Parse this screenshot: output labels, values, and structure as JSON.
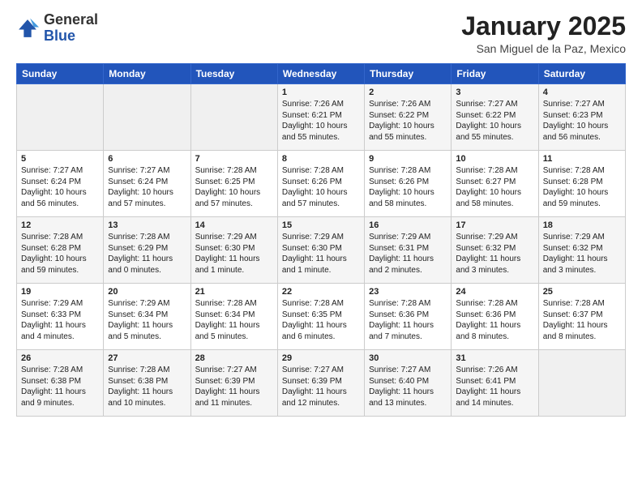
{
  "header": {
    "logo_general": "General",
    "logo_blue": "Blue",
    "main_title": "January 2025",
    "subtitle": "San Miguel de la Paz, Mexico"
  },
  "weekdays": [
    "Sunday",
    "Monday",
    "Tuesday",
    "Wednesday",
    "Thursday",
    "Friday",
    "Saturday"
  ],
  "weeks": [
    [
      {
        "day": "",
        "info": ""
      },
      {
        "day": "",
        "info": ""
      },
      {
        "day": "",
        "info": ""
      },
      {
        "day": "1",
        "info": "Sunrise: 7:26 AM\nSunset: 6:21 PM\nDaylight: 10 hours\nand 55 minutes."
      },
      {
        "day": "2",
        "info": "Sunrise: 7:26 AM\nSunset: 6:22 PM\nDaylight: 10 hours\nand 55 minutes."
      },
      {
        "day": "3",
        "info": "Sunrise: 7:27 AM\nSunset: 6:22 PM\nDaylight: 10 hours\nand 55 minutes."
      },
      {
        "day": "4",
        "info": "Sunrise: 7:27 AM\nSunset: 6:23 PM\nDaylight: 10 hours\nand 56 minutes."
      }
    ],
    [
      {
        "day": "5",
        "info": "Sunrise: 7:27 AM\nSunset: 6:24 PM\nDaylight: 10 hours\nand 56 minutes."
      },
      {
        "day": "6",
        "info": "Sunrise: 7:27 AM\nSunset: 6:24 PM\nDaylight: 10 hours\nand 57 minutes."
      },
      {
        "day": "7",
        "info": "Sunrise: 7:28 AM\nSunset: 6:25 PM\nDaylight: 10 hours\nand 57 minutes."
      },
      {
        "day": "8",
        "info": "Sunrise: 7:28 AM\nSunset: 6:26 PM\nDaylight: 10 hours\nand 57 minutes."
      },
      {
        "day": "9",
        "info": "Sunrise: 7:28 AM\nSunset: 6:26 PM\nDaylight: 10 hours\nand 58 minutes."
      },
      {
        "day": "10",
        "info": "Sunrise: 7:28 AM\nSunset: 6:27 PM\nDaylight: 10 hours\nand 58 minutes."
      },
      {
        "day": "11",
        "info": "Sunrise: 7:28 AM\nSunset: 6:28 PM\nDaylight: 10 hours\nand 59 minutes."
      }
    ],
    [
      {
        "day": "12",
        "info": "Sunrise: 7:28 AM\nSunset: 6:28 PM\nDaylight: 10 hours\nand 59 minutes."
      },
      {
        "day": "13",
        "info": "Sunrise: 7:28 AM\nSunset: 6:29 PM\nDaylight: 11 hours\nand 0 minutes."
      },
      {
        "day": "14",
        "info": "Sunrise: 7:29 AM\nSunset: 6:30 PM\nDaylight: 11 hours\nand 1 minute."
      },
      {
        "day": "15",
        "info": "Sunrise: 7:29 AM\nSunset: 6:30 PM\nDaylight: 11 hours\nand 1 minute."
      },
      {
        "day": "16",
        "info": "Sunrise: 7:29 AM\nSunset: 6:31 PM\nDaylight: 11 hours\nand 2 minutes."
      },
      {
        "day": "17",
        "info": "Sunrise: 7:29 AM\nSunset: 6:32 PM\nDaylight: 11 hours\nand 3 minutes."
      },
      {
        "day": "18",
        "info": "Sunrise: 7:29 AM\nSunset: 6:32 PM\nDaylight: 11 hours\nand 3 minutes."
      }
    ],
    [
      {
        "day": "19",
        "info": "Sunrise: 7:29 AM\nSunset: 6:33 PM\nDaylight: 11 hours\nand 4 minutes."
      },
      {
        "day": "20",
        "info": "Sunrise: 7:29 AM\nSunset: 6:34 PM\nDaylight: 11 hours\nand 5 minutes."
      },
      {
        "day": "21",
        "info": "Sunrise: 7:28 AM\nSunset: 6:34 PM\nDaylight: 11 hours\nand 5 minutes."
      },
      {
        "day": "22",
        "info": "Sunrise: 7:28 AM\nSunset: 6:35 PM\nDaylight: 11 hours\nand 6 minutes."
      },
      {
        "day": "23",
        "info": "Sunrise: 7:28 AM\nSunset: 6:36 PM\nDaylight: 11 hours\nand 7 minutes."
      },
      {
        "day": "24",
        "info": "Sunrise: 7:28 AM\nSunset: 6:36 PM\nDaylight: 11 hours\nand 8 minutes."
      },
      {
        "day": "25",
        "info": "Sunrise: 7:28 AM\nSunset: 6:37 PM\nDaylight: 11 hours\nand 8 minutes."
      }
    ],
    [
      {
        "day": "26",
        "info": "Sunrise: 7:28 AM\nSunset: 6:38 PM\nDaylight: 11 hours\nand 9 minutes."
      },
      {
        "day": "27",
        "info": "Sunrise: 7:28 AM\nSunset: 6:38 PM\nDaylight: 11 hours\nand 10 minutes."
      },
      {
        "day": "28",
        "info": "Sunrise: 7:27 AM\nSunset: 6:39 PM\nDaylight: 11 hours\nand 11 minutes."
      },
      {
        "day": "29",
        "info": "Sunrise: 7:27 AM\nSunset: 6:39 PM\nDaylight: 11 hours\nand 12 minutes."
      },
      {
        "day": "30",
        "info": "Sunrise: 7:27 AM\nSunset: 6:40 PM\nDaylight: 11 hours\nand 13 minutes."
      },
      {
        "day": "31",
        "info": "Sunrise: 7:26 AM\nSunset: 6:41 PM\nDaylight: 11 hours\nand 14 minutes."
      },
      {
        "day": "",
        "info": ""
      }
    ]
  ]
}
